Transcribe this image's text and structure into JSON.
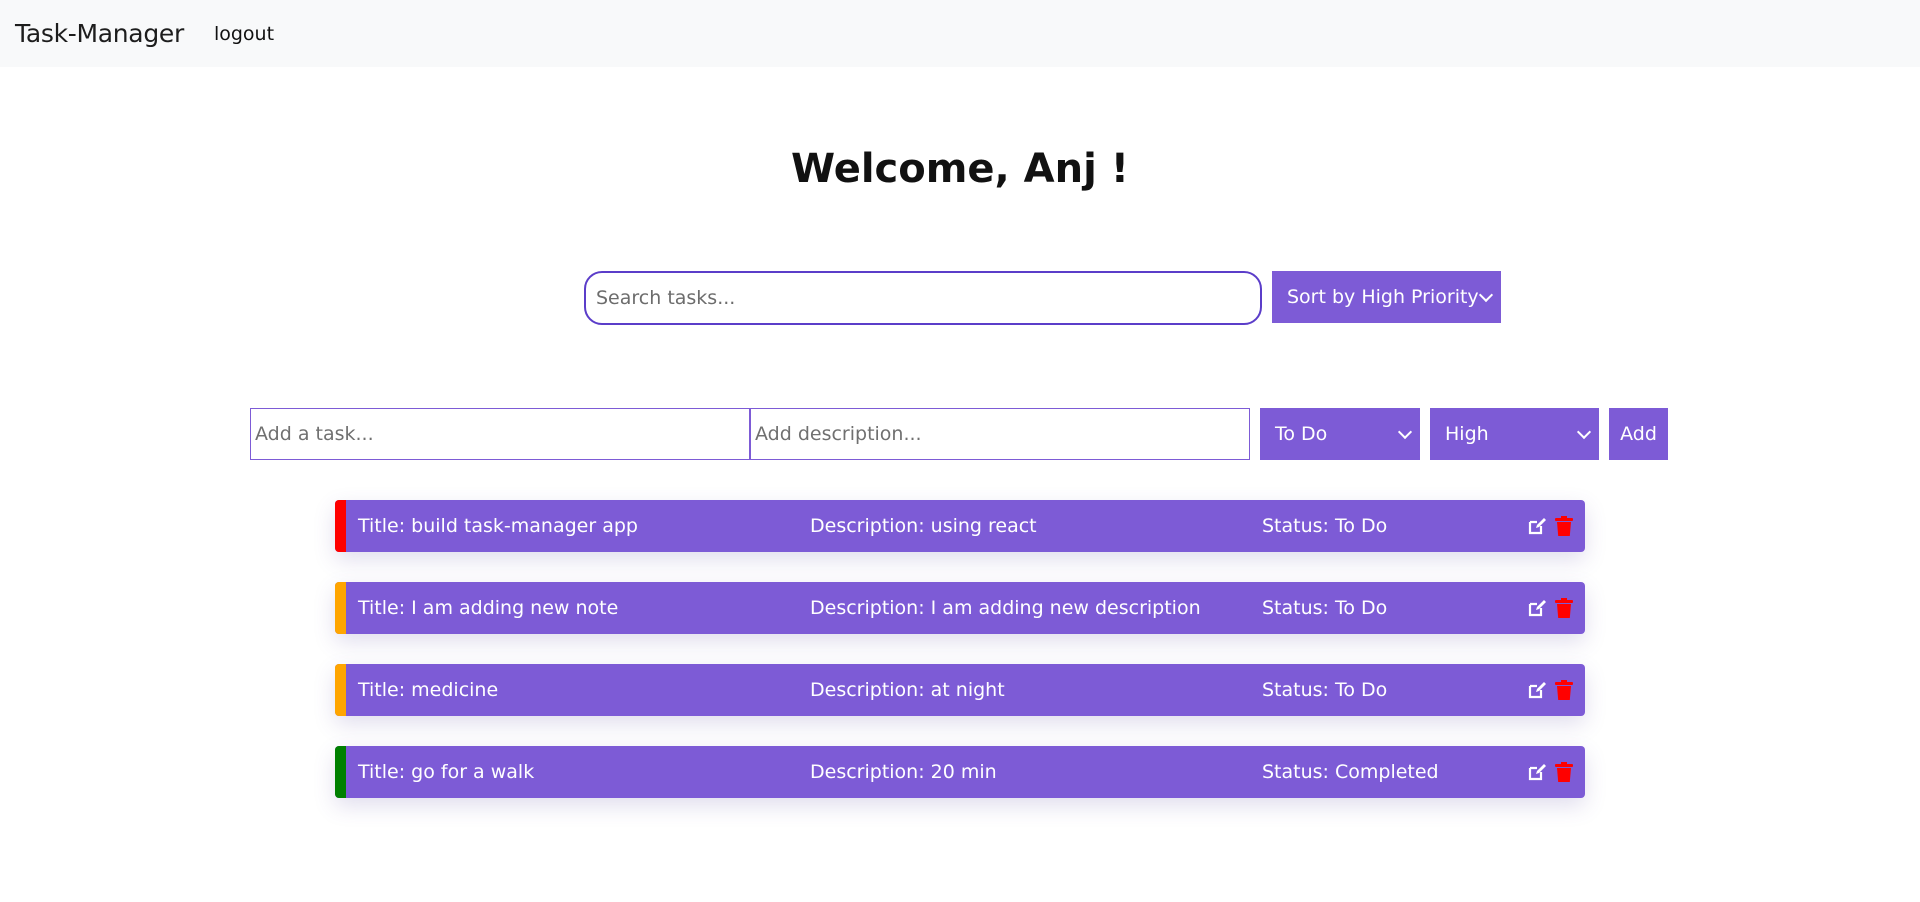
{
  "navbar": {
    "brand": "Task-Manager",
    "logout_label": "logout"
  },
  "welcome": "Welcome, Anj !",
  "search": {
    "placeholder": "Search tasks...",
    "sort_selected": "Sort by High Priority"
  },
  "add_form": {
    "task_placeholder": "Add a task...",
    "description_placeholder": "Add description...",
    "status_selected": "To Do",
    "priority_selected": "High",
    "add_label": "Add"
  },
  "colors": {
    "accent": "#7d5bd6",
    "priority_high": "#ff0000",
    "priority_medium": "#ffa500",
    "priority_low": "#008000",
    "delete_icon": "#ff0000"
  },
  "tasks": [
    {
      "title": "Title: build task-manager app",
      "description": "Description: using react",
      "status": "Status: To Do",
      "priority_color": "#ff0000"
    },
    {
      "title": "Title: I am adding new note",
      "description": "Description: I am adding new description",
      "status": "Status: To Do",
      "priority_color": "#ffa500"
    },
    {
      "title": "Title: medicine",
      "description": "Description: at night",
      "status": "Status: To Do",
      "priority_color": "#ffa500"
    },
    {
      "title": "Title: go for a walk",
      "description": "Description: 20 min",
      "status": "Status: Completed",
      "priority_color": "#008000"
    }
  ],
  "icons": {
    "edit": "edit-icon",
    "delete": "trash-icon"
  }
}
